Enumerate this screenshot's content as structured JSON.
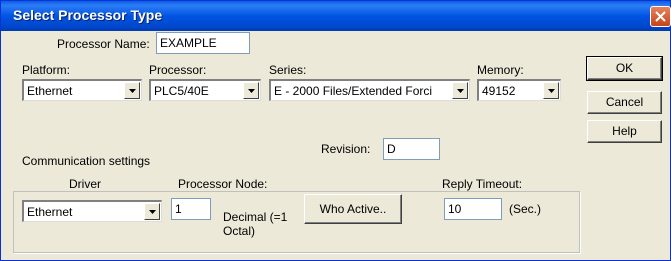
{
  "window": {
    "title": "Select Processor Type"
  },
  "icons": {
    "close": "close-icon",
    "dropdown": "chevron-down-icon"
  },
  "fields": {
    "processor_name": {
      "label": "Processor Name:",
      "value": "EXAMPLE"
    },
    "platform": {
      "label": "Platform:",
      "value": "Ethernet"
    },
    "processor": {
      "label": "Processor:",
      "value": "PLC5/40E"
    },
    "series": {
      "label": "Series:",
      "value": "E - 2000 Files/Extended Forci"
    },
    "memory": {
      "label": "Memory:",
      "value": "49152"
    },
    "revision": {
      "label": "Revision:",
      "value": "D"
    }
  },
  "buttons": {
    "ok": "OK",
    "cancel": "Cancel",
    "help": "Help"
  },
  "communication": {
    "group_label": "Communication settings",
    "driver_label": "Driver",
    "driver_value": "Ethernet",
    "node_label": "Processor Node:",
    "node_value": "1",
    "node_note": "Decimal (=1 Octal)",
    "who_active_label": "Who Active..",
    "timeout_label": "Reply Timeout:",
    "timeout_value": "10",
    "timeout_unit": "(Sec.)"
  }
}
